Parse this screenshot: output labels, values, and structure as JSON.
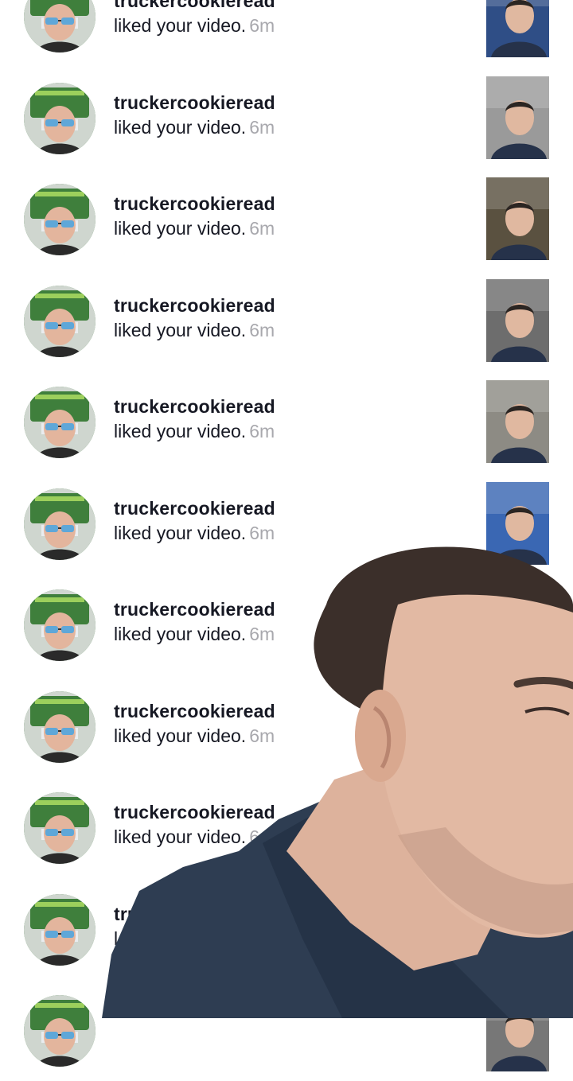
{
  "notifications": [
    {
      "username": "truckercookieread",
      "action": "liked your video.",
      "time": "6m",
      "thumb_tone": "#2f4e86"
    },
    {
      "username": "truckercookieread",
      "action": "liked your video.",
      "time": "6m",
      "thumb_tone": "#9a9a9a"
    },
    {
      "username": "truckercookieread",
      "action": "liked your video.",
      "time": "6m",
      "thumb_tone": "#5a5140"
    },
    {
      "username": "truckercookieread",
      "action": "liked your video.",
      "time": "6m",
      "thumb_tone": "#6d6d6d"
    },
    {
      "username": "truckercookieread",
      "action": "liked your video.",
      "time": "6m",
      "thumb_tone": "#8d8b84"
    },
    {
      "username": "truckercookieread",
      "action": "liked your video.",
      "time": "6m",
      "thumb_tone": "#3a67b3"
    },
    {
      "username": "truckercookieread",
      "action": "liked your video.",
      "time": "6m",
      "thumb_tone": "#6a50a0"
    },
    {
      "username": "truckercookieread",
      "action": "liked your video.",
      "time": "6m",
      "thumb_tone": "#777777"
    },
    {
      "username": "truckercookieread",
      "action": "liked your video.",
      "time": "6",
      "thumb_tone": "#777777"
    },
    {
      "username": "truc",
      "action": "l",
      "time": "",
      "thumb_tone": "#777777"
    },
    {
      "username": "",
      "action": "",
      "time": "",
      "thumb_tone": "#777777"
    }
  ],
  "colors": {
    "primary_text": "#161823",
    "secondary_text": "#a8a8ad",
    "avatar_green": "#3f7f3c",
    "overlay_shirt": "#2e3d52",
    "overlay_skin": "#e2b9a3"
  },
  "icons": {
    "avatar": "truck-driver-avatar",
    "overlay": "presenter-cutout"
  }
}
